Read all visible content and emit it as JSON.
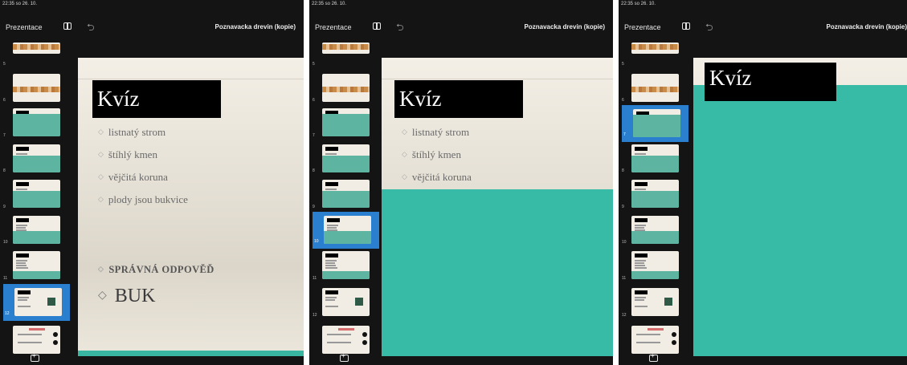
{
  "status_bar": {
    "time": "22:35  so 26. 10."
  },
  "toolbar": {
    "menu_label": "Prezentace",
    "doc_title": "Poznavacka drevin (kopie)",
    "panel_icon": "sidebar-icon",
    "undo_icon": "undo-icon"
  },
  "slide_numbers": [
    "5",
    "6",
    "7",
    "8",
    "9",
    "10",
    "11",
    "12"
  ],
  "add_slide_icon": "plus-icon",
  "slide": {
    "title": "Kvíz",
    "bullets": [
      "listnatý strom",
      "štíhlý kmen",
      "vějčitá koruna",
      "plody jsou bukvice"
    ],
    "answer_label": "SPRÁVNÁ ODPOVĚĎ",
    "answer": "BUK"
  },
  "colors": {
    "teal": "#38bba6",
    "selection": "#2a7fce",
    "background": "#141414"
  }
}
